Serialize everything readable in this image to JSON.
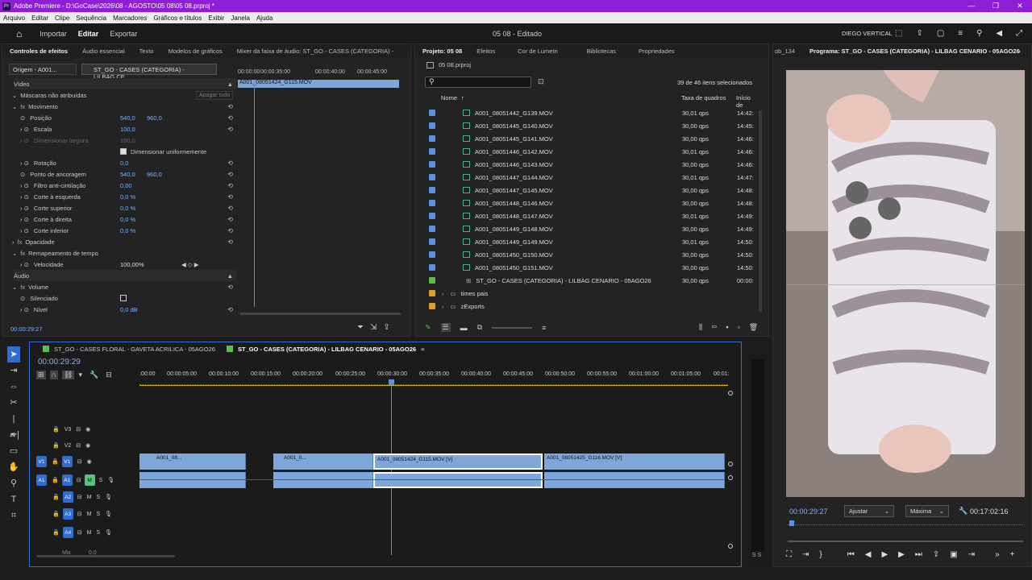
{
  "window": {
    "title": "Adobe Premiere - D:\\GoCase\\2026\\08 - AGOSTO\\05 08\\05 08.prproj *",
    "app_icon": "Pr"
  },
  "menu": [
    "Arquivo",
    "Editar",
    "Clipe",
    "Sequência",
    "Marcadores",
    "Gráficos e títulos",
    "Exibir",
    "Janela",
    "Ajuda"
  ],
  "topnav": {
    "tabs": [
      "Importar",
      "Editar",
      "Exportar"
    ],
    "center": "05 08 - Editado",
    "workspace": "DIEGO VERTICAL"
  },
  "effects_panel": {
    "tabs": [
      "Controles de efeitos",
      "Áudio essencial",
      "Texto",
      "Modelos de gráficos",
      "Mixer da faixa de áudio: ST_GO - CASES (CATEGORIA) -"
    ],
    "source_chip": "Origem - A001...",
    "seq_chip": "ST_GO - CASES (CATEGORIA) - LILBAG CE...",
    "ruler": [
      "00:00:00",
      "00:00:35:00",
      "00:00:40:00",
      "00:00:45:00"
    ],
    "mini_clip": "A001_08051424_G115.MOV",
    "video_label": "Vídeo",
    "masks": "Máscaras não atribuídas",
    "clear_all": "Apagar tudo",
    "motion": "Movimento",
    "props": [
      {
        "name": "Posição",
        "v1": "540,0",
        "v2": "960,0"
      },
      {
        "name": "Escala",
        "v1": "100,0",
        "v2": ""
      },
      {
        "name": "Dimensionar largura",
        "v1": "100,0",
        "v2": ""
      },
      {
        "name": "Dimensionar uniformemente",
        "v1": "",
        "v2": ""
      },
      {
        "name": "Rotação",
        "v1": "0,0",
        "v2": ""
      },
      {
        "name": "Ponto de ancoragem",
        "v1": "540,0",
        "v2": "960,0"
      },
      {
        "name": "Filtro anti-cintilação",
        "v1": "0,00",
        "v2": ""
      },
      {
        "name": "Corte à esquerda",
        "v1": "0,0 %",
        "v2": ""
      },
      {
        "name": "Corte superior",
        "v1": "0,0 %",
        "v2": ""
      },
      {
        "name": "Corte à direita",
        "v1": "0,0 %",
        "v2": ""
      },
      {
        "name": "Corte inferior",
        "v1": "0,0 %",
        "v2": ""
      }
    ],
    "opacity": "Opacidade",
    "time_remap": "Remapeamento de tempo",
    "speed": {
      "name": "Velocidade",
      "value": "100,00%"
    },
    "audio_label": "Áudio",
    "volume": "Volume",
    "mute": "Silenciado",
    "level": {
      "name": "Nível",
      "value": "0,0 dB"
    },
    "timecode": "00:00:29:27"
  },
  "project_panel": {
    "tabs": [
      "Projeto: 05 08",
      "Efeitos",
      "Cor de Lumetri",
      "Bibliotecas",
      "Propriedades"
    ],
    "file": "05 08.prproj",
    "selected_count": "39 de 46 itens selecionados",
    "columns": [
      "Nome",
      "Taxa de quadros",
      "Início de"
    ],
    "items": [
      {
        "name": "A001_08051442_G139.MOV",
        "fps": "30,01 qps",
        "start": "14:42:"
      },
      {
        "name": "A001_08051445_G140.MOV",
        "fps": "30,00 qps",
        "start": "14:45:"
      },
      {
        "name": "A001_08051445_G141.MOV",
        "fps": "30,00 qps",
        "start": "14:46:"
      },
      {
        "name": "A001_08051446_G142.MOV",
        "fps": "30,01 qps",
        "start": "14:46:"
      },
      {
        "name": "A001_08051446_G143.MOV",
        "fps": "30,00 qps",
        "start": "14:46:"
      },
      {
        "name": "A001_08051447_G144.MOV",
        "fps": "30,01 qps",
        "start": "14:47:"
      },
      {
        "name": "A001_08051447_G145.MOV",
        "fps": "30,00 qps",
        "start": "14:48:"
      },
      {
        "name": "A001_08051448_G146.MOV",
        "fps": "30,00 qps",
        "start": "14:48:"
      },
      {
        "name": "A001_08051448_G147.MOV",
        "fps": "30,01 qps",
        "start": "14:49:"
      },
      {
        "name": "A001_08051449_G148.MOV",
        "fps": "30,00 qps",
        "start": "14:49:"
      },
      {
        "name": "A001_08051449_G149.MOV",
        "fps": "30,01 qps",
        "start": "14:50:"
      },
      {
        "name": "A001_08051450_G150.MOV",
        "fps": "30,00 qps",
        "start": "14:50:"
      },
      {
        "name": "A001_08051450_G151.MOV",
        "fps": "30,00 qps",
        "start": "14:50:"
      }
    ],
    "sequence": {
      "name": "ST_GO - CASES (CATEGORIA) - LILBAG CENARIO - 05AGO26",
      "fps": "30,00 qps",
      "start": "00:00:"
    },
    "folders": [
      "times pais",
      "zExports"
    ]
  },
  "program_panel": {
    "tabs": [
      "ɑb_134",
      "Programa: ST_GO - CASES (CATEGORIA) - LILBAG CENARIO - 05AGO26"
    ],
    "timecode": "00:00:29:27",
    "fit": "Ajustar",
    "quality": "Máxima",
    "duration": "00:17:02:16"
  },
  "timeline": {
    "tabs": [
      "ST_GO - CASES FLORAL - GAVETA ACRILICA - 05AGO26",
      "ST_GO - CASES (CATEGORIA) - LILBAG CENARIO - 05AGO26"
    ],
    "timecode": "00:00:29:29",
    "ruler": [
      ":00:00",
      "00:00:05:00",
      "00:00:10:00",
      "00:00:15:00",
      "00:00:20:00",
      "00:00:25:00",
      "00:00:30:00",
      "00:00:35:00",
      "00:00:40:00",
      "00:00:45:00",
      "00:00:50:00",
      "00:00:55:00",
      "00:01:00:00",
      "00:01:05:00",
      "00:01:"
    ],
    "tracks": [
      "V3",
      "V2",
      "V1",
      "A1",
      "A2",
      "A3",
      "A4"
    ],
    "clips": {
      "c1": "A001_08...",
      "c2": "A001_0...",
      "c3": "A001_08051424_G115.MOV [V]",
      "c4": "A001_08051425_G116.MOV [V]"
    },
    "mix": "Mix",
    "mix_val": "0,0"
  },
  "colors": {
    "accent": "#2f6dd0",
    "title_bar": "#8f1fd6",
    "clip": "#7ea6d8",
    "folder": "#e0a030",
    "sequence": "#5cbf4a"
  },
  "icons": [
    "home-icon",
    "search-icon",
    "select-tool-icon",
    "playhead-icon",
    "play-icon",
    "folder-icon"
  ]
}
